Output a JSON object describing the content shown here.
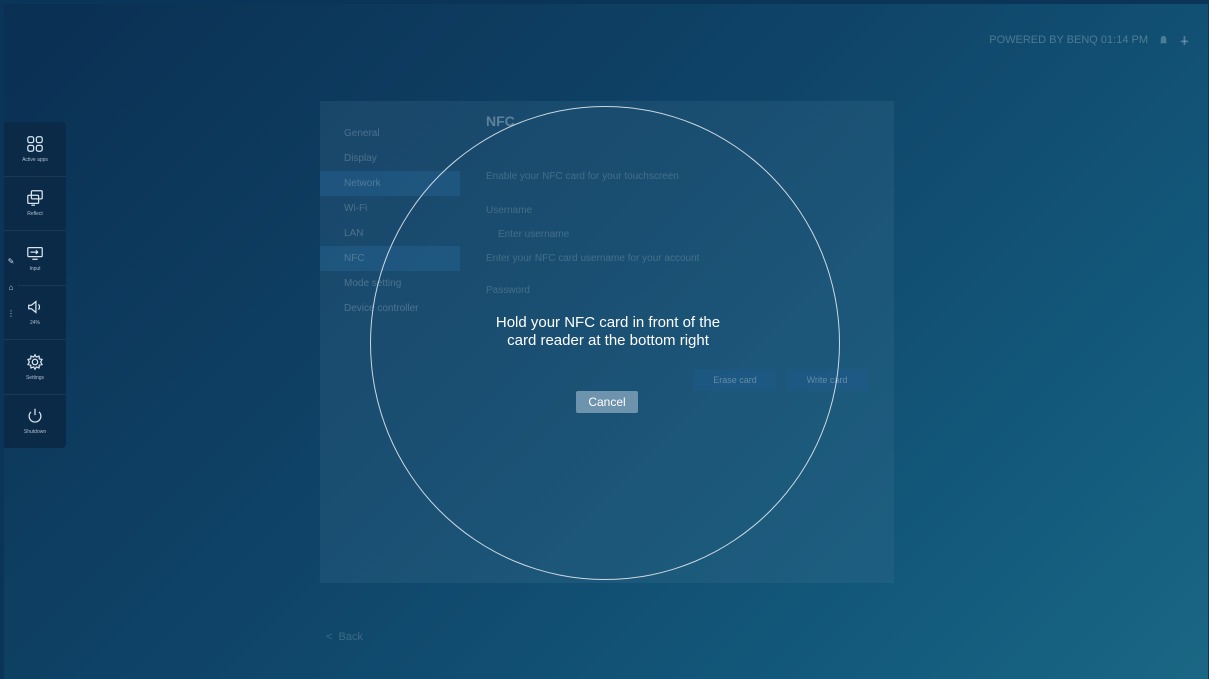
{
  "statusbar": {
    "text": "POWERED BY BENQ 01:14 PM"
  },
  "sidebar": {
    "items": [
      {
        "label": "Active apps",
        "icon": "apps-icon"
      },
      {
        "label": "Reflect",
        "icon": "reflect-icon"
      },
      {
        "label": "Input",
        "icon": "input-icon"
      },
      {
        "label": "24%",
        "icon": "volume-icon"
      },
      {
        "label": "Settings",
        "icon": "gear-icon"
      },
      {
        "label": "Shutdown",
        "icon": "power-icon"
      }
    ]
  },
  "background_panel": {
    "nav": [
      "General",
      "Display",
      "Network",
      "Wi-Fi",
      "LAN",
      "NFC",
      "Mode setting",
      "Device controller"
    ],
    "title": "NFC",
    "prompt": "Enable your NFC card for your touchscreen",
    "username_label": "Username",
    "username_value": "Enter username",
    "username_hint": "Enter your NFC card username for your account",
    "password_label": "Password",
    "erase_button": "Erase card",
    "write_button": "Write card"
  },
  "back_label": "Back",
  "dialog": {
    "message": "Hold your NFC card in front of the card reader at the bottom right",
    "cancel_label": "Cancel"
  }
}
